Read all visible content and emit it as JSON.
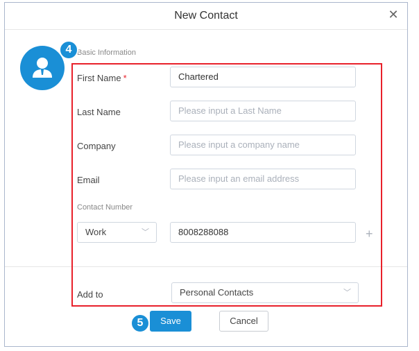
{
  "dialog": {
    "title": "New Contact",
    "close_icon": "close-icon"
  },
  "avatar": {
    "icon": "user-icon",
    "color": "#1a8fd6"
  },
  "steps": {
    "four": "4",
    "five": "5"
  },
  "highlight_color": "#e8202a",
  "form": {
    "section_basic": "Basic Information",
    "first_name": {
      "label": "First Name",
      "required_mark": "*",
      "value": "Chartered"
    },
    "last_name": {
      "label": "Last Name",
      "placeholder": "Please input a Last Name"
    },
    "company": {
      "label": "Company",
      "placeholder": "Please input a company name"
    },
    "email": {
      "label": "Email",
      "placeholder": "Please input an email address"
    },
    "section_contact_number": "Contact Number",
    "phone_type": "Work",
    "phone_value": "8008288088",
    "add_to": {
      "label": "Add to",
      "value": "Personal Contacts"
    }
  },
  "buttons": {
    "save": "Save",
    "cancel": "Cancel"
  }
}
